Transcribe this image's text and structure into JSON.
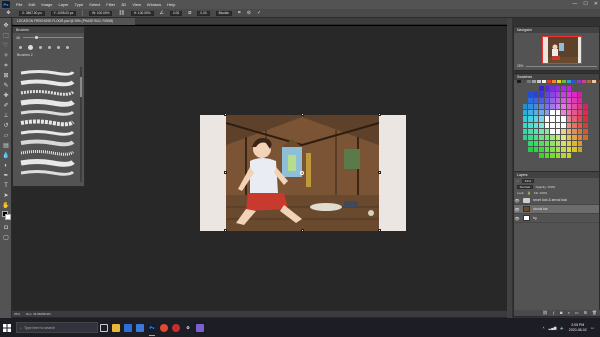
{
  "menubar": {
    "logo": "Ps",
    "items": [
      "File",
      "Edit",
      "Image",
      "Layer",
      "Type",
      "Select",
      "Filter",
      "3D",
      "View",
      "Window",
      "Help"
    ],
    "window_controls": [
      "—",
      "☐",
      "✕"
    ]
  },
  "options": {
    "x": "X: 3867.50 px",
    "y": "Y: 1008.00 px",
    "w": "W: 100.00%",
    "h": "H: 100.00%",
    "angle": "0.00",
    "hskew": "0.00",
    "interp": "Bicubic"
  },
  "document": {
    "tab_title": "LOCATION FREEHOSE FLOOR.psd @ 25% (PHASE BG2, RGB/8)"
  },
  "brushes_panel": {
    "title": "Brushes",
    "size_value": "46",
    "group_name": "Brushes 2"
  },
  "navigator": {
    "title": "Navigator",
    "zoom": "25%"
  },
  "swatches": {
    "title": "Swatches",
    "row_colors": [
      "#1a1a1a",
      "#4d4d4d",
      "#7a7a7a",
      "#a0a0a0",
      "#c8c8c8",
      "#f0f0f0",
      "#e63b2e",
      "#f08a24",
      "#f4d22c",
      "#6abf3f",
      "#2fa4d8",
      "#3554c9",
      "#8a3fc2",
      "#d63c8c",
      "#a86b3c",
      "#e8c7a0",
      "#5a3b22",
      "#ffffff"
    ]
  },
  "layers": {
    "title": "Layers",
    "filter": "Kind",
    "blend_mode": "Normal",
    "opacity": "Opacity: 100%",
    "lock": "Lock:",
    "fill": "Fill: 100%",
    "rows": [
      {
        "name": "smart look & arrival look"
      },
      {
        "name": "clouds bar"
      },
      {
        "name": "bg"
      }
    ]
  },
  "statusbar": {
    "zoom": "25%",
    "doc": "Doc: 45.8M/88.9M"
  },
  "taskbar": {
    "search_placeholder": "Type here to search",
    "time": "2:05 PM",
    "date": "2020-08-02"
  }
}
